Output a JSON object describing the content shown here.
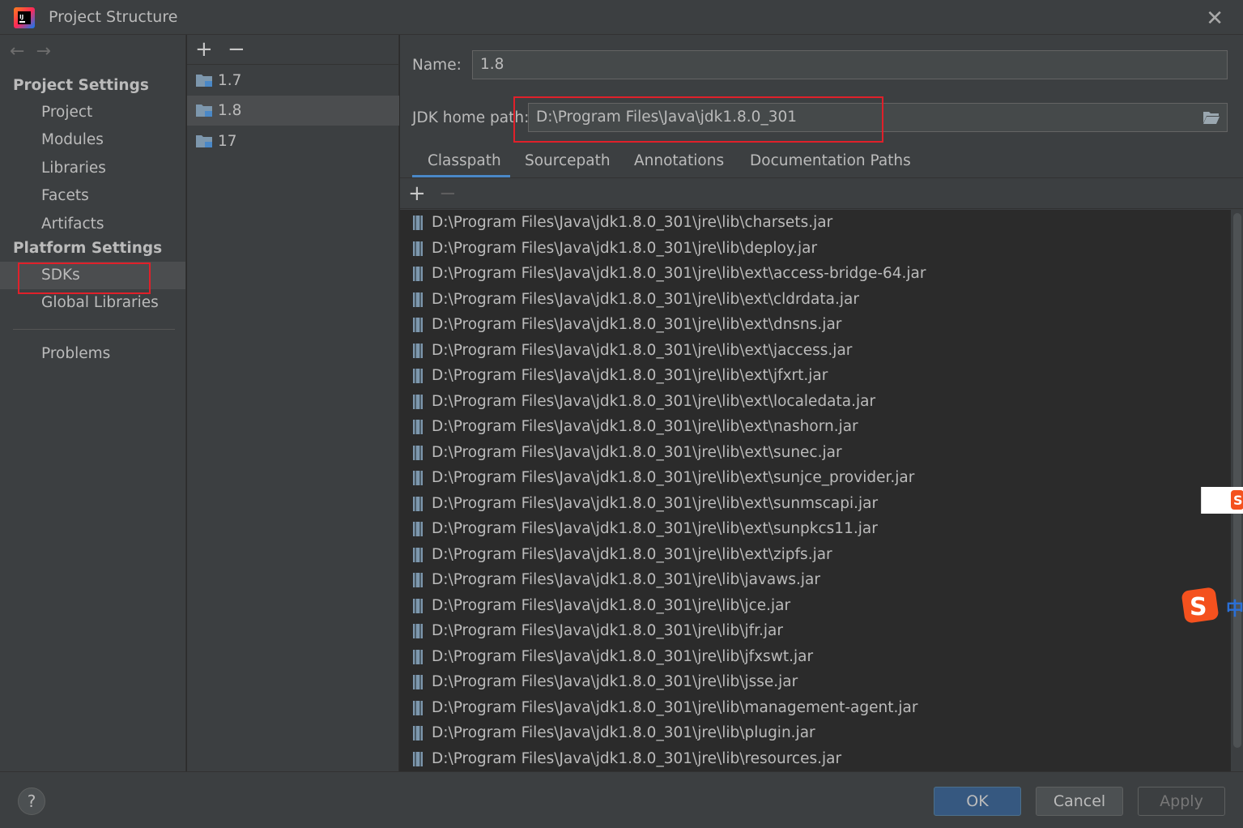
{
  "window": {
    "title": "Project Structure",
    "close_label": "✕"
  },
  "nav": {
    "back": "←",
    "forward": "→"
  },
  "sidebar": {
    "project_settings_header": "Project Settings",
    "project_items": [
      "Project",
      "Modules",
      "Libraries",
      "Facets",
      "Artifacts"
    ],
    "platform_settings_header": "Platform Settings",
    "platform_items": [
      "SDKs",
      "Global Libraries"
    ],
    "problems": "Problems",
    "selected": "SDKs"
  },
  "sdk_list": {
    "add": "+",
    "remove": "−",
    "items": [
      "1.7",
      "1.8",
      "17"
    ],
    "selected": "1.8"
  },
  "details": {
    "name_label": "Name:",
    "name_value": "1.8",
    "jdk_home_label": "JDK home path:",
    "jdk_home_value": "D:\\Program Files\\Java\\jdk1.8.0_301",
    "tabs": [
      "Classpath",
      "Sourcepath",
      "Annotations",
      "Documentation Paths"
    ],
    "active_tab": "Classpath",
    "cp_add": "+",
    "cp_remove": "−",
    "classpath": [
      "D:\\Program Files\\Java\\jdk1.8.0_301\\jre\\lib\\charsets.jar",
      "D:\\Program Files\\Java\\jdk1.8.0_301\\jre\\lib\\deploy.jar",
      "D:\\Program Files\\Java\\jdk1.8.0_301\\jre\\lib\\ext\\access-bridge-64.jar",
      "D:\\Program Files\\Java\\jdk1.8.0_301\\jre\\lib\\ext\\cldrdata.jar",
      "D:\\Program Files\\Java\\jdk1.8.0_301\\jre\\lib\\ext\\dnsns.jar",
      "D:\\Program Files\\Java\\jdk1.8.0_301\\jre\\lib\\ext\\jaccess.jar",
      "D:\\Program Files\\Java\\jdk1.8.0_301\\jre\\lib\\ext\\jfxrt.jar",
      "D:\\Program Files\\Java\\jdk1.8.0_301\\jre\\lib\\ext\\localedata.jar",
      "D:\\Program Files\\Java\\jdk1.8.0_301\\jre\\lib\\ext\\nashorn.jar",
      "D:\\Program Files\\Java\\jdk1.8.0_301\\jre\\lib\\ext\\sunec.jar",
      "D:\\Program Files\\Java\\jdk1.8.0_301\\jre\\lib\\ext\\sunjce_provider.jar",
      "D:\\Program Files\\Java\\jdk1.8.0_301\\jre\\lib\\ext\\sunmscapi.jar",
      "D:\\Program Files\\Java\\jdk1.8.0_301\\jre\\lib\\ext\\sunpkcs11.jar",
      "D:\\Program Files\\Java\\jdk1.8.0_301\\jre\\lib\\ext\\zipfs.jar",
      "D:\\Program Files\\Java\\jdk1.8.0_301\\jre\\lib\\javaws.jar",
      "D:\\Program Files\\Java\\jdk1.8.0_301\\jre\\lib\\jce.jar",
      "D:\\Program Files\\Java\\jdk1.8.0_301\\jre\\lib\\jfr.jar",
      "D:\\Program Files\\Java\\jdk1.8.0_301\\jre\\lib\\jfxswt.jar",
      "D:\\Program Files\\Java\\jdk1.8.0_301\\jre\\lib\\jsse.jar",
      "D:\\Program Files\\Java\\jdk1.8.0_301\\jre\\lib\\management-agent.jar",
      "D:\\Program Files\\Java\\jdk1.8.0_301\\jre\\lib\\plugin.jar",
      "D:\\Program Files\\Java\\jdk1.8.0_301\\jre\\lib\\resources.jar"
    ]
  },
  "footer": {
    "help": "?",
    "ok": "OK",
    "cancel": "Cancel",
    "apply": "Apply"
  },
  "ime": {
    "char": "中"
  },
  "colors": {
    "accent": "#4a88c7",
    "highlight_box": "#e0202a",
    "ok_button": "#365880"
  }
}
